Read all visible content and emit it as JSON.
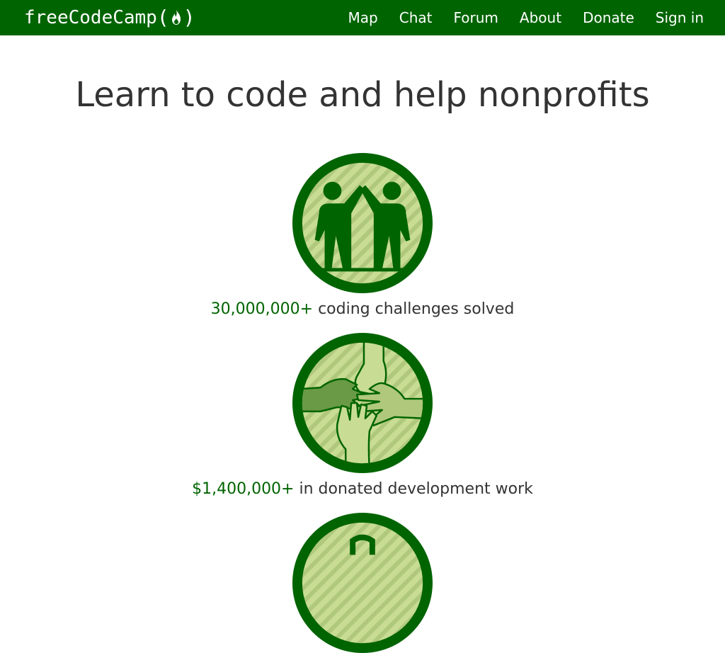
{
  "navbar": {
    "logo_text": "freeCodeCamp",
    "logo_open": "(",
    "logo_close": ")",
    "links": [
      {
        "label": "Map"
      },
      {
        "label": "Chat"
      },
      {
        "label": "Forum"
      },
      {
        "label": "About"
      },
      {
        "label": "Donate"
      },
      {
        "label": "Sign in"
      }
    ]
  },
  "hero": {
    "title": "Learn to code and help nonprofits"
  },
  "stats": [
    {
      "number": "30,000,000+",
      "text": "coding challenges solved",
      "icon": "high-five-icon"
    },
    {
      "number": "$1,400,000+",
      "text": "in donated development work",
      "icon": "stacked-hands-icon"
    },
    {
      "icon": "badge-icon"
    }
  ],
  "colors": {
    "brand": "#006400",
    "badge_light": "#c8dc94",
    "badge_stripe": "#b0c87c",
    "text": "#333333"
  }
}
